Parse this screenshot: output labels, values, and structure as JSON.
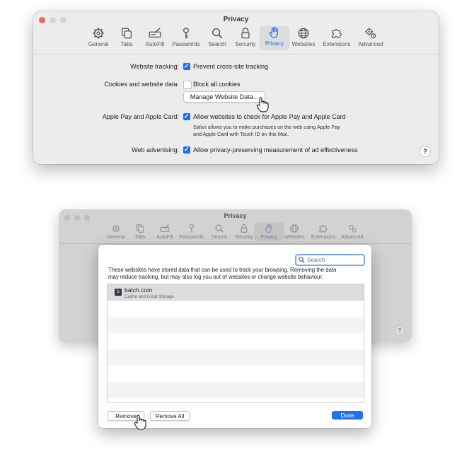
{
  "win1": {
    "title": "Privacy",
    "toolbar": [
      {
        "label": "General",
        "icon": "gear-icon"
      },
      {
        "label": "Tabs",
        "icon": "tabs-icon"
      },
      {
        "label": "AutoFill",
        "icon": "autofill-icon"
      },
      {
        "label": "Passwords",
        "icon": "key-icon"
      },
      {
        "label": "Search",
        "icon": "magnifier-icon"
      },
      {
        "label": "Security",
        "icon": "lock-icon"
      },
      {
        "label": "Privacy",
        "icon": "hand-icon"
      },
      {
        "label": "Websites",
        "icon": "globe-icon"
      },
      {
        "label": "Extensions",
        "icon": "puzzle-icon"
      },
      {
        "label": "Advanced",
        "icon": "gears-icon"
      }
    ],
    "settings": {
      "tracking_label": "Website tracking:",
      "tracking_option": "Prevent cross-site tracking",
      "cookies_label": "Cookies and website data:",
      "cookies_option": "Block all cookies",
      "manage_button": "Manage Website Data...",
      "applepay_label": "Apple Pay and Apple Card:",
      "applepay_option": "Allow websites to check for Apple Pay and Apple Card",
      "applepay_note_1": "Safari allows you to make purchases on the web using Apple Pay",
      "applepay_note_2": "and Apple Card with Touch ID on this Mac.",
      "ads_label": "Web advertising:",
      "ads_option": "Allow privacy-preserving measurement of ad effectiveness",
      "help": "?"
    }
  },
  "win2": {
    "title": "Privacy",
    "help": "?"
  },
  "sheet": {
    "search_placeholder": "Search",
    "description_1": "These websites have stored data that can be used to track your browsing. Removing the data",
    "description_2": "may reduce tracking, but may also log you out of websites or change website behaviour.",
    "sites": [
      {
        "favicon": "b",
        "name": "batch.com",
        "detail": "Cache and Local Storage"
      }
    ],
    "remove_button": "Remove",
    "remove_all_button": "Remove All",
    "done_button": "Done"
  },
  "colors": {
    "accent": "#1d6ff2",
    "close": "#fe5f57",
    "traffic_inactive": "#cfcfcf"
  }
}
